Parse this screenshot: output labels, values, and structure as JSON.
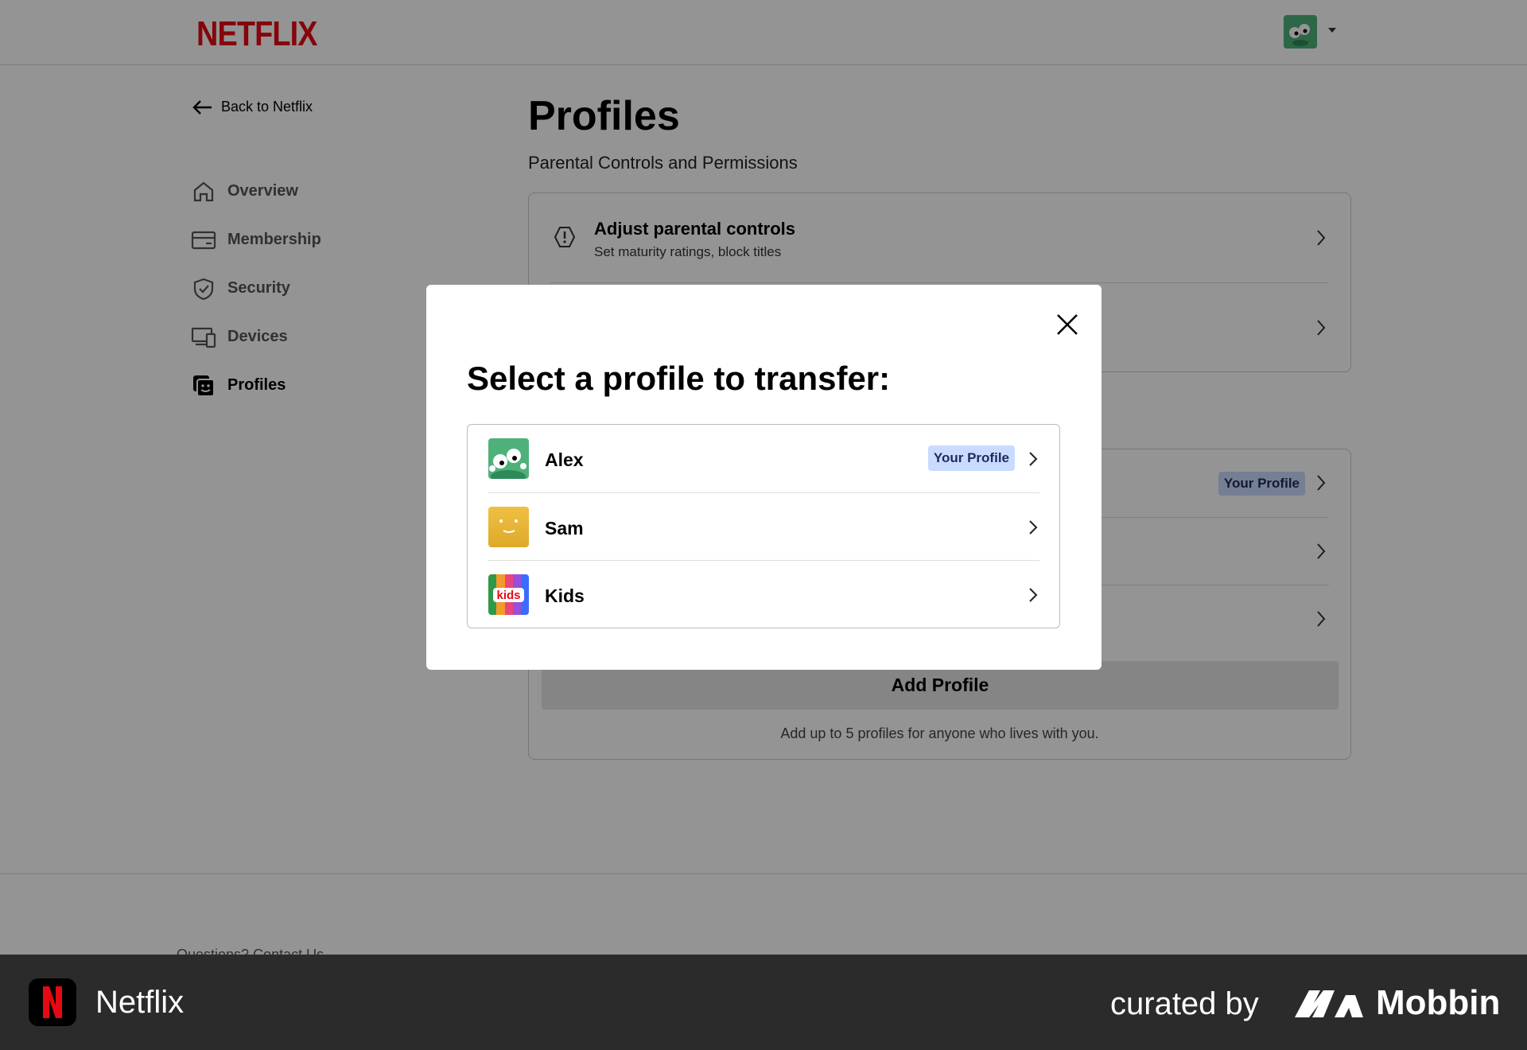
{
  "header": {
    "logo_text": "NETFLIX",
    "brand_color": "#e50914"
  },
  "sidebar": {
    "back_label": "Back to Netflix",
    "items": [
      {
        "label": "Overview",
        "icon": "home-icon"
      },
      {
        "label": "Membership",
        "icon": "card-icon"
      },
      {
        "label": "Security",
        "icon": "shield-icon"
      },
      {
        "label": "Devices",
        "icon": "devices-icon"
      },
      {
        "label": "Profiles",
        "icon": "profiles-icon",
        "active": true
      }
    ]
  },
  "main": {
    "title": "Profiles",
    "subtitle": "Parental Controls and Permissions",
    "parental": {
      "title": "Adjust parental controls",
      "subtitle": "Set maturity ratings, block titles"
    },
    "profiles_badge": "Your Profile",
    "add_profile_label": "Add Profile",
    "add_profile_note": "Add up to 5 profiles for anyone who lives with you."
  },
  "footer": {
    "text": "Questions? Contact Us."
  },
  "modal": {
    "title": "Select a profile to transfer:",
    "profiles": [
      {
        "name": "Alex",
        "badge": "Your Profile",
        "avatar_color": "#4fb17a"
      },
      {
        "name": "Sam",
        "avatar_color": "#e7b535"
      },
      {
        "name": "Kids",
        "avatar_label": "kids"
      }
    ]
  },
  "attribution": {
    "app_name": "Netflix",
    "curated_by": "curated by",
    "brand": "Mobbin"
  }
}
